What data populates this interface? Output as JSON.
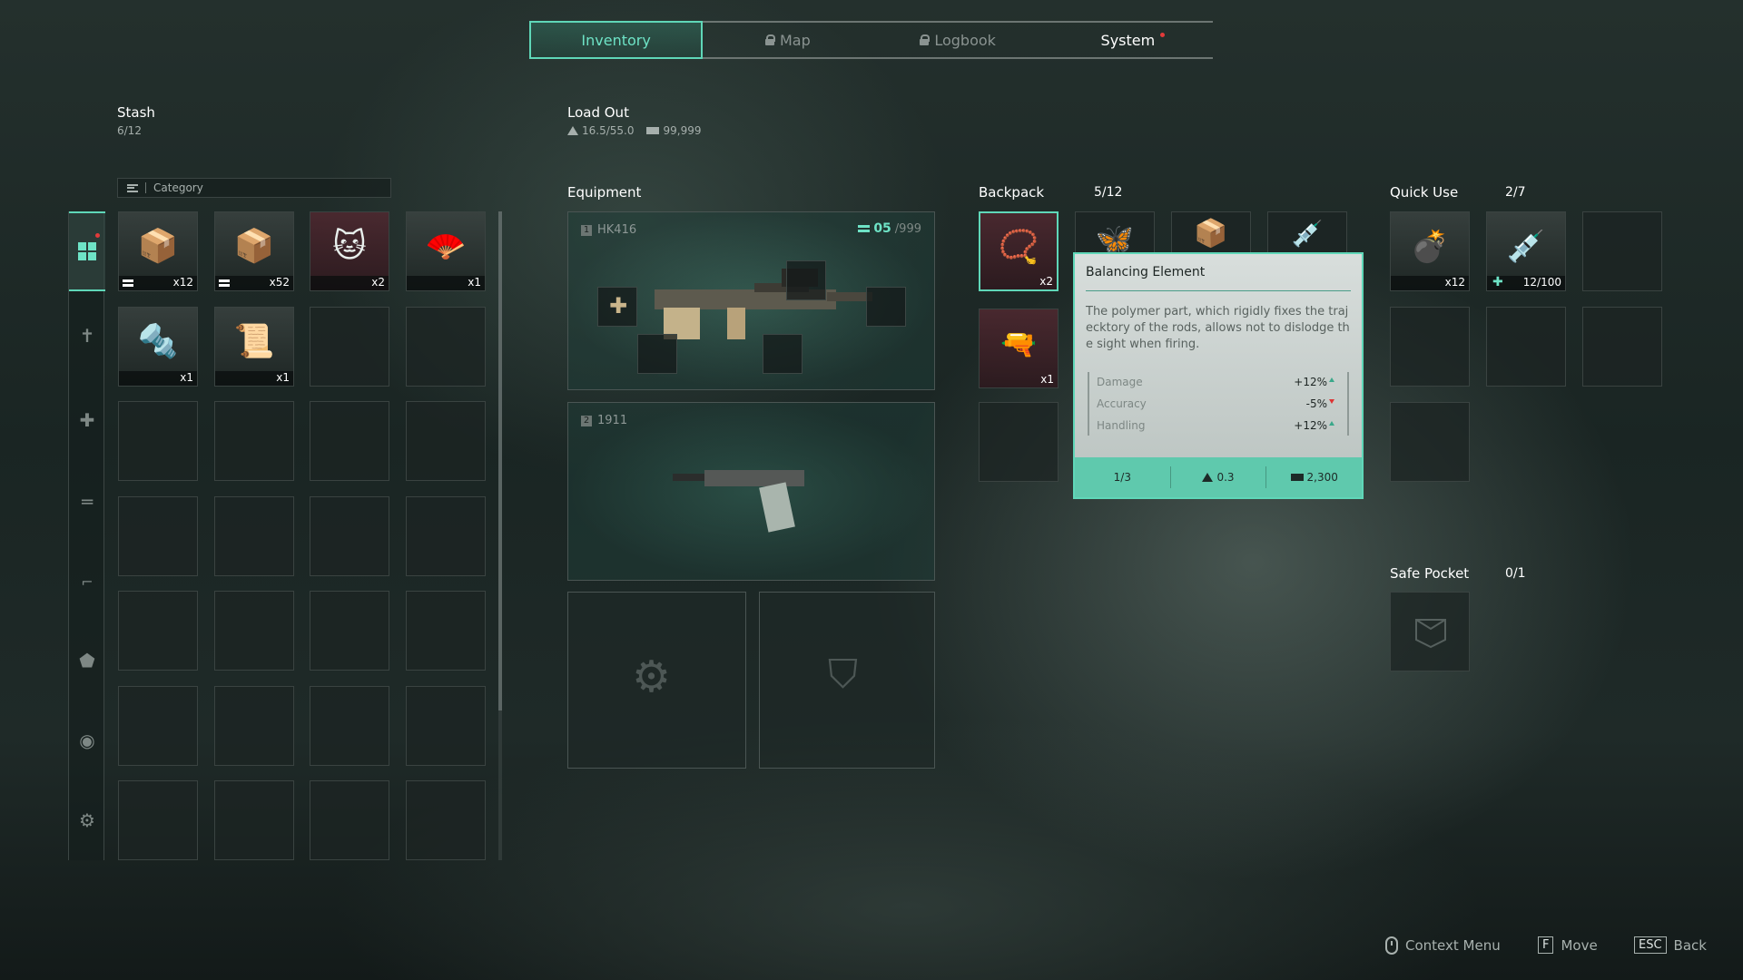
{
  "tabs": [
    {
      "label": "Inventory",
      "locked": false
    },
    {
      "label": "Map",
      "locked": true
    },
    {
      "label": "Logbook",
      "locked": true
    },
    {
      "label": "System",
      "locked": false
    }
  ],
  "stash": {
    "title": "Stash",
    "capacity": "6/12",
    "category_label": "Category",
    "items": [
      {
        "name": "ammo box",
        "qty": "x12",
        "ammo": true,
        "glyph": "📦"
      },
      {
        "name": "ammo box blue",
        "qty": "x52",
        "ammo": true,
        "glyph": "📦"
      },
      {
        "name": "lucky cat",
        "qty": "x2",
        "ammo": false,
        "glyph": "🐱"
      },
      {
        "name": "folding fan",
        "qty": "x1",
        "ammo": false,
        "glyph": "🪭"
      },
      {
        "name": "gun part",
        "qty": "x1",
        "ammo": false,
        "glyph": "🔩"
      },
      {
        "name": "talisman",
        "qty": "x1",
        "ammo": false,
        "glyph": "📜"
      }
    ]
  },
  "loadout": {
    "title": "Load Out",
    "weight": "16.5/55.0",
    "money": "99,999"
  },
  "equipment": {
    "title": "Equipment",
    "primary": {
      "slot": "1",
      "name": "HK416",
      "ammo_current": "05",
      "ammo_max": "/999"
    },
    "secondary": {
      "slot": "2",
      "name": "1911"
    }
  },
  "backpack": {
    "title": "Backpack",
    "capacity": "5/12",
    "items": [
      {
        "name": "rosary",
        "qty": "x2"
      },
      {
        "name": "rifle",
        "qty": "x1"
      }
    ]
  },
  "tooltip": {
    "title": "Balancing Element",
    "description": "The polymer part, which rigidly fixes the trajecktory of the rods, allows not to dislodge the sight when firing.",
    "stats": [
      {
        "name": "Damage",
        "value": "+12%",
        "dir": "up"
      },
      {
        "name": "Accuracy",
        "value": "-5%",
        "dir": "down"
      },
      {
        "name": "Handling",
        "value": "+12%",
        "dir": "up"
      }
    ],
    "stack": "1/3",
    "weight": "0.3",
    "price": "2,300"
  },
  "quick_use": {
    "title": "Quick Use",
    "capacity": "2/7",
    "items": [
      {
        "name": "grenade",
        "qty": "x12"
      },
      {
        "name": "syringe",
        "qty": "12/100"
      }
    ]
  },
  "safe_pocket": {
    "title": "Safe Pocket",
    "capacity": "0/1"
  },
  "hints": [
    {
      "key": "",
      "label": "Context Menu"
    },
    {
      "key": "F",
      "label": "Move"
    },
    {
      "key": "ESC",
      "label": "Back"
    }
  ],
  "colors": {
    "accent": "#5fd7b8",
    "alert": "#e23a3a"
  }
}
